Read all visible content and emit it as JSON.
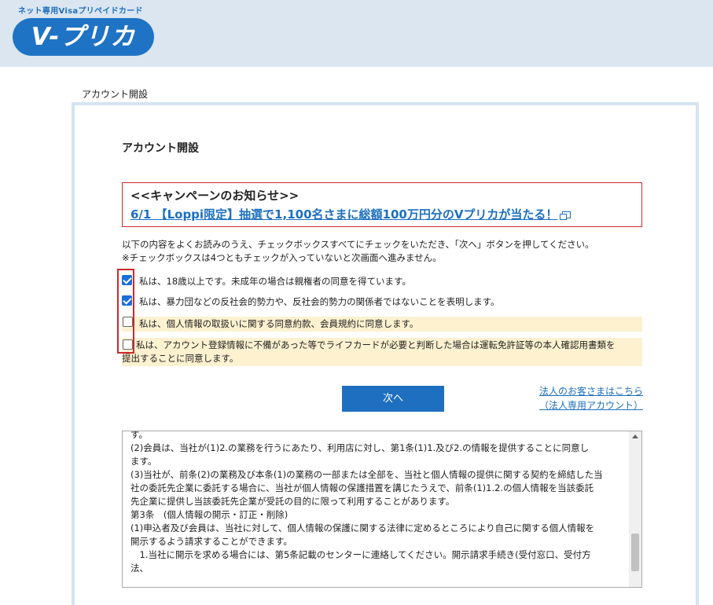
{
  "header": {
    "tagline": "ネット専用Visaプリペイドカード",
    "logo_text": "V-プリカ"
  },
  "breadcrumb": "アカウント開設",
  "page_title": "アカウント開設",
  "campaign": {
    "title": "<<キャンペーンのお知らせ>>",
    "link": "6/1 【Loppi限定】抽選で1,100名さまに総額100万円分のVプリカが当たる！"
  },
  "instructions": [
    "以下の内容をよくお読みのうえ、チェックボックスすべてにチェックをいただき、「次へ」ボタンを押してください。",
    "※チェックボックスは4つともチェックが入っていないと次画面へ進みません。"
  ],
  "checkboxes": [
    {
      "label": "私は、18歳以上です。未成年の場合は親権者の同意を得ています。",
      "checked": true
    },
    {
      "label": "私は、暴力団などの反社会的勢力や、反社会的勢力の関係者ではないことを表明します。",
      "checked": true
    },
    {
      "label": "私は、個人情報の取扱いに関する同意約款、会員規約に同意します。",
      "checked": false
    },
    {
      "label": "私は、アカウント登録情報に不備があった等でライフカードが必要と判断した場合は運転免許証等の本人確認用書類を",
      "label2": "提出することに同意します。",
      "checked": false
    }
  ],
  "next_button": "次へ",
  "corporate_link": {
    "line1": "法人のお客さまはこちら",
    "line2": "（法人専用アカウント）"
  },
  "terms_lines": [
    "す。",
    "(2)会員は、当社が(1)2.の業務を行うにあたり、利用店に対し、第1条(1)1.及び2.の情報を提供することに同意し",
    "ます。",
    "(3)当社が、前条(2)の業務及び本条(1)の業務の一部または全部を、当社と個人情報の提供に関する契約を締結した当",
    "社の委託先企業に委託する場合に、当社が個人情報の保護措置を講じたうえで、前条(1)1.2.の個人情報を当該委託",
    "先企業に提供し当該委託先企業が受託の目的に限って利用することがあります。",
    "第3条　(個人情報の開示・訂正・削除)",
    "(1)申込者及び会員は、当社に対して、個人情報の保護に関する法律に定めるところにより自己に関する個人情報を",
    "開示するよう請求することができます。",
    "　1.当社に開示を求める場合には、第5条記載のセンターに連絡してください。開示請求手続き(受付窓口、受付方",
    "法、"
  ]
}
